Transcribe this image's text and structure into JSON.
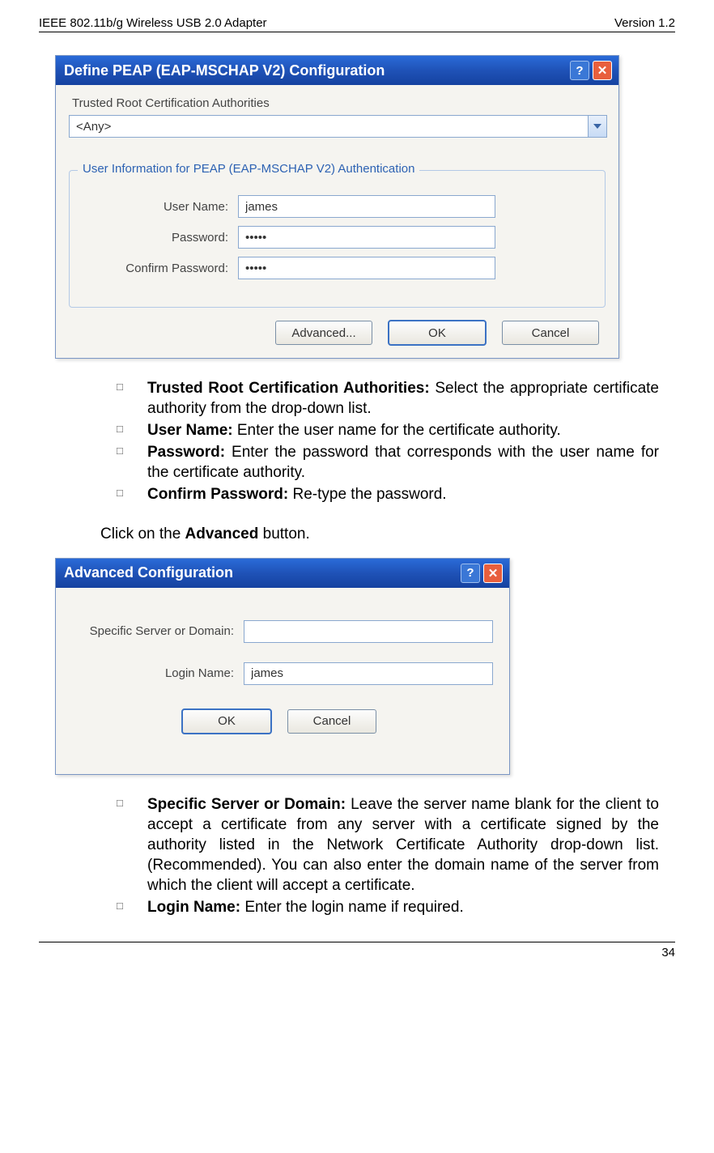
{
  "header": {
    "left": "IEEE 802.11b/g Wireless USB 2.0 Adapter",
    "right": "Version 1.2"
  },
  "footer": {
    "page": "34"
  },
  "win1": {
    "title": "Define PEAP (EAP-MSCHAP V2) Configuration",
    "trca_label": "Trusted Root Certification Authorities",
    "dropdown_value": "<Any>",
    "legend": "User Information for PEAP (EAP-MSCHAP V2) Authentication",
    "rows": {
      "user_label": "User Name:",
      "user_value": "james",
      "pass_label": "Password:",
      "pass_value": "•••••",
      "conf_label": "Confirm Password:",
      "conf_value": "•••••"
    },
    "buttons": {
      "advanced": "Advanced...",
      "ok": "OK",
      "cancel": "Cancel"
    }
  },
  "bullets1": {
    "b1_bold": "Trusted Root Certification Authorities:",
    "b1_rest": " Select the appropriate certificate authority from the drop-down list.",
    "b2_bold": "User Name:",
    "b2_rest": " Enter the user name for the certificate authority.",
    "b3_bold": "Password:",
    "b3_rest": " Enter the password that corresponds with the user name for the certificate authority.",
    "b4_bold": "Confirm Password:",
    "b4_rest": " Re-type the password."
  },
  "mid_para_pre": "Click on the ",
  "mid_para_bold": "Advanced",
  "mid_para_post": " button.",
  "win2": {
    "title": "Advanced Configuration",
    "rows": {
      "server_label": "Specific Server or Domain:",
      "server_value": "",
      "login_label": "Login Name:",
      "login_value": "james"
    },
    "buttons": {
      "ok": "OK",
      "cancel": "Cancel"
    }
  },
  "bullets2": {
    "b1_bold": "Specific Server or Domain:",
    "b1_rest": " Leave the server name blank for the client to accept a certificate from any server with a certificate signed by the authority listed in the Network Certificate Authority drop-down list. (Recommended). You can also enter the domain name of the server from which the client will accept a certificate.",
    "b2_bold": "Login Name:",
    "b2_rest": " Enter the login name if required."
  }
}
